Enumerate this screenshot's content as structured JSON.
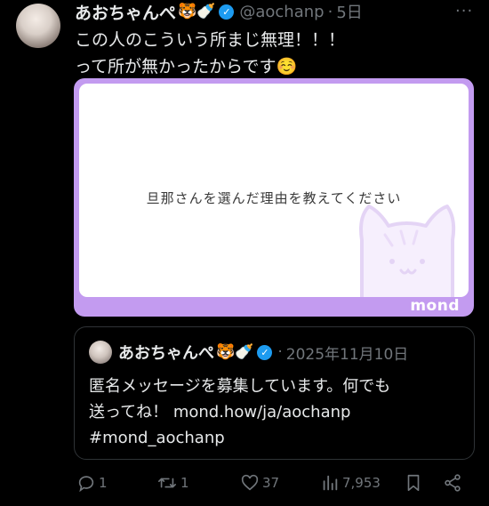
{
  "tweet": {
    "display_name": "あおちゃんぺ",
    "name_emojis": "🐯🍼",
    "handle": "@aochanp",
    "separator": "·",
    "time": "5日",
    "more": "···",
    "text_line1": "この人のこういう所まじ無理！！！",
    "text_line2": "って所が無かったからです☺️"
  },
  "card": {
    "question": "旦那さんを選んだ理由を教えてください",
    "logo": "mond",
    "accent_color": "#c39bf0"
  },
  "quote": {
    "display_name": "あおちゃんぺ",
    "name_emojis": "🐯🍼",
    "separator": "·",
    "date": "2025年11月10日",
    "text_line1": "匿名メッセージを募集しています。何でも",
    "text_line2": "送ってね！ mond.how/ja/aochanp",
    "text_line3": "#mond_aochanp"
  },
  "actions": {
    "replies": "1",
    "retweets": "1",
    "likes": "37",
    "views": "7,953"
  },
  "icons": {
    "verified": "verified-badge-icon",
    "reply": "reply-icon",
    "retweet": "retweet-icon",
    "like": "heart-icon",
    "views": "views-chart-icon",
    "bookmark": "bookmark-icon",
    "share": "share-icon"
  },
  "colors": {
    "background": "#000000",
    "text": "#e7e9ea",
    "muted": "#71767b",
    "verified": "#1d9bf0"
  }
}
